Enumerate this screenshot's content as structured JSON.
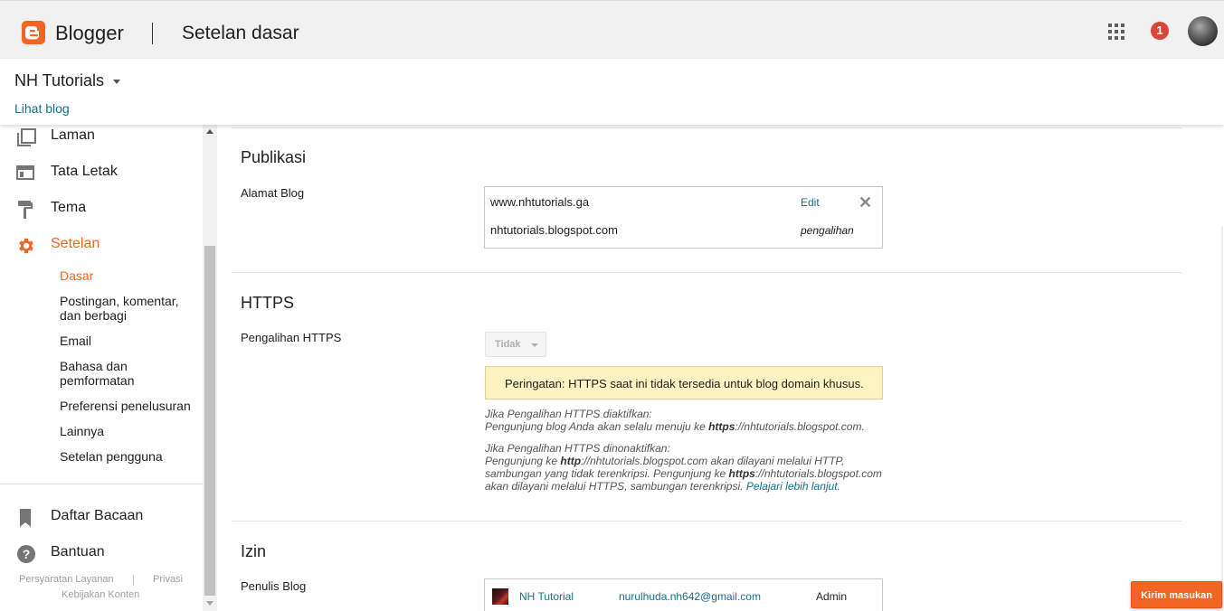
{
  "header": {
    "brand": "Blogger",
    "page_title": "Setelan dasar",
    "notification_count": "1"
  },
  "blog": {
    "name": "NH Tutorials",
    "view_link": "Lihat blog"
  },
  "sidebar": {
    "items": [
      {
        "label": "Laman",
        "icon": "pages-icon"
      },
      {
        "label": "Tata Letak",
        "icon": "layout-icon"
      },
      {
        "label": "Tema",
        "icon": "paint-roller-icon"
      },
      {
        "label": "Setelan",
        "icon": "gear-icon"
      }
    ],
    "subitems": [
      "Dasar",
      "Postingan, komentar, dan berbagi",
      "Email",
      "Bahasa dan pemformatan",
      "Preferensi penelusuran",
      "Lainnya",
      "Setelan pengguna"
    ],
    "bottom_items": [
      {
        "label": "Daftar Bacaan",
        "icon": "bookmark-icon"
      },
      {
        "label": "Bantuan",
        "icon": "help-icon"
      }
    ],
    "footer": {
      "terms": "Persyaratan Layanan",
      "privacy": "Privasi",
      "content_policy": "Kebijakan Konten"
    }
  },
  "publikasi": {
    "title": "Publikasi",
    "label": "Alamat Blog",
    "custom_domain": "www.nhtutorials.ga",
    "edit": "Edit",
    "blogspot_domain": "nhtutorials.blogspot.com",
    "redirect_note": "pengalihan"
  },
  "https": {
    "title": "HTTPS",
    "label": "Pengalihan HTTPS",
    "dropdown_value": "Tidak",
    "warning": "Peringatan: HTTPS saat ini tidak tersedia untuk blog domain khusus.",
    "enabled_heading": "Jika Pengalihan HTTPS diaktifkan:",
    "enabled_text_1": "Pengunjung blog Anda akan selalu menuju ke ",
    "enabled_bold": "https",
    "enabled_text_2": "://nhtutorials.blogspot.com.",
    "disabled_heading": "Jika Pengalihan HTTPS dinonaktifkan:",
    "disabled_text_1": "Pengunjung ke ",
    "disabled_bold_1": "http",
    "disabled_text_2": "://nhtutorials.blogspot.com akan dilayani melalui HTTP, sambungan yang tidak terenkripsi. Pengunjung ke ",
    "disabled_bold_2": "https",
    "disabled_text_3": "://nhtutorials.blogspot.com akan dilayani melalui HTTPS, sambungan terenkripsi. ",
    "learn_more": "Pelajari lebih lanjut."
  },
  "izin": {
    "title": "Izin",
    "label": "Penulis Blog",
    "author_name": "NH Tutorial",
    "author_email": "nurulhuda.nh642@gmail.com",
    "author_role": "Admin"
  },
  "feedback_button": "Kirim masukan",
  "colors": {
    "accent": "#f26522",
    "link": "#1a6d8a",
    "warning_bg": "#fff3c4",
    "notification": "#db4437"
  }
}
